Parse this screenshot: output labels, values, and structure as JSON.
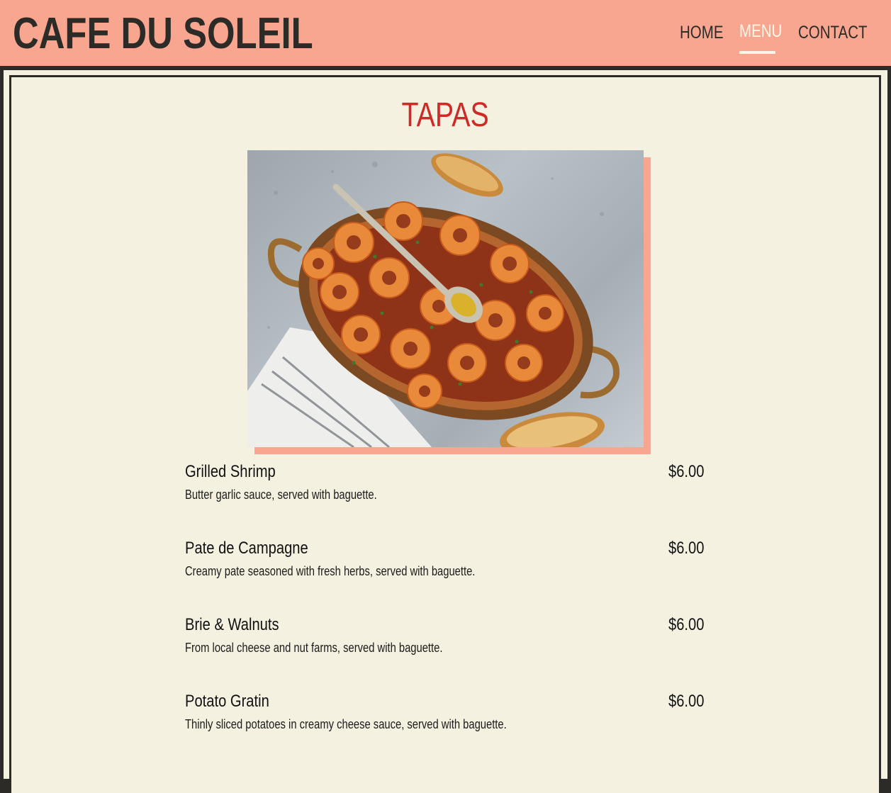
{
  "header": {
    "brand": "CAFE DU SOLEIL",
    "nav": [
      {
        "label": "HOME",
        "active": false
      },
      {
        "label": "MENU",
        "active": true
      },
      {
        "label": "CONTACT",
        "active": false
      }
    ]
  },
  "colors": {
    "header_bg": "#f8a68f",
    "page_bg": "#f5f1e1",
    "frame": "#2d2b28",
    "title": "#cf2a27",
    "active_nav": "#fdf6e8"
  },
  "section": {
    "title": "TAPAS",
    "photo_icon": "shrimp-dish-photo"
  },
  "menu_items": [
    {
      "name": "Grilled Shrimp",
      "price": "$6.00",
      "description": "Butter garlic sauce, served with baguette."
    },
    {
      "name": "Pate de Campagne",
      "price": "$6.00",
      "description": "Creamy pate seasoned with fresh herbs, served with baguette."
    },
    {
      "name": "Brie & Walnuts",
      "price": "$6.00",
      "description": "From local cheese and nut farms, served with baguette."
    },
    {
      "name": "Potato Gratin",
      "price": "$6.00",
      "description": "Thinly sliced potatoes in creamy cheese sauce, served with baguette."
    }
  ]
}
